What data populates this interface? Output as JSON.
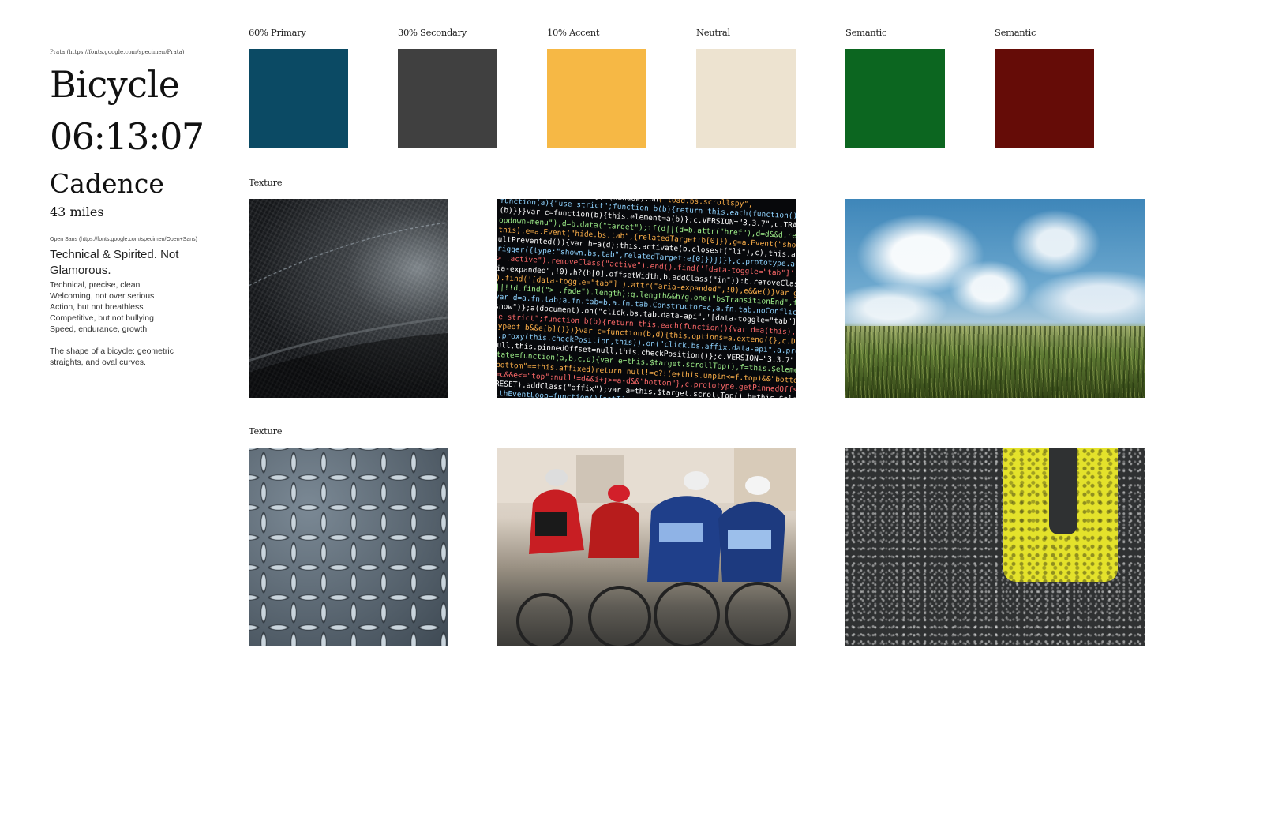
{
  "type_specimen": {
    "serif_font_source": "Prata (https://fonts.google.com/specimen/Prata)",
    "word_large": "Bicycle",
    "time_large": "06:13:07",
    "word_medium": "Cadence",
    "distance": "43 miles",
    "sans_font_source": "Open Sans (https://fonts.google.com/specimen/Open+Sans)",
    "lead": "Technical & Spirited.  Not Glamorous.",
    "points": [
      "Technical, precise, clean",
      "Welcoming, not over serious",
      "Action, but not breathless",
      "Competitive, but not bullying",
      "Speed, endurance, growth"
    ],
    "shape_note": "The shape of a bicycle: geometric straights, and oval curves."
  },
  "palette": [
    {
      "label": "60% Primary",
      "color": "#0b4a64"
    },
    {
      "label": "30% Secondary",
      "color": "#404040"
    },
    {
      "label": "10% Accent",
      "color": "#f6b845"
    },
    {
      "label": "Neutral",
      "color": "#ede3d0"
    },
    {
      "label": "Semantic",
      "color": "#0c6620"
    },
    {
      "label": "Semantic",
      "color": "#650c07"
    }
  ],
  "textures": {
    "row1_label": "Texture",
    "row2_label": "Texture",
    "images": [
      {
        "icon": "carbon-fiber-image"
      },
      {
        "icon": "source-code-image"
      },
      {
        "icon": "sky-field-image"
      },
      {
        "icon": "diamond-plate-image"
      },
      {
        "icon": "cyclists-race-image"
      },
      {
        "icon": "asphalt-yellow-line-image"
      }
    ]
  }
}
